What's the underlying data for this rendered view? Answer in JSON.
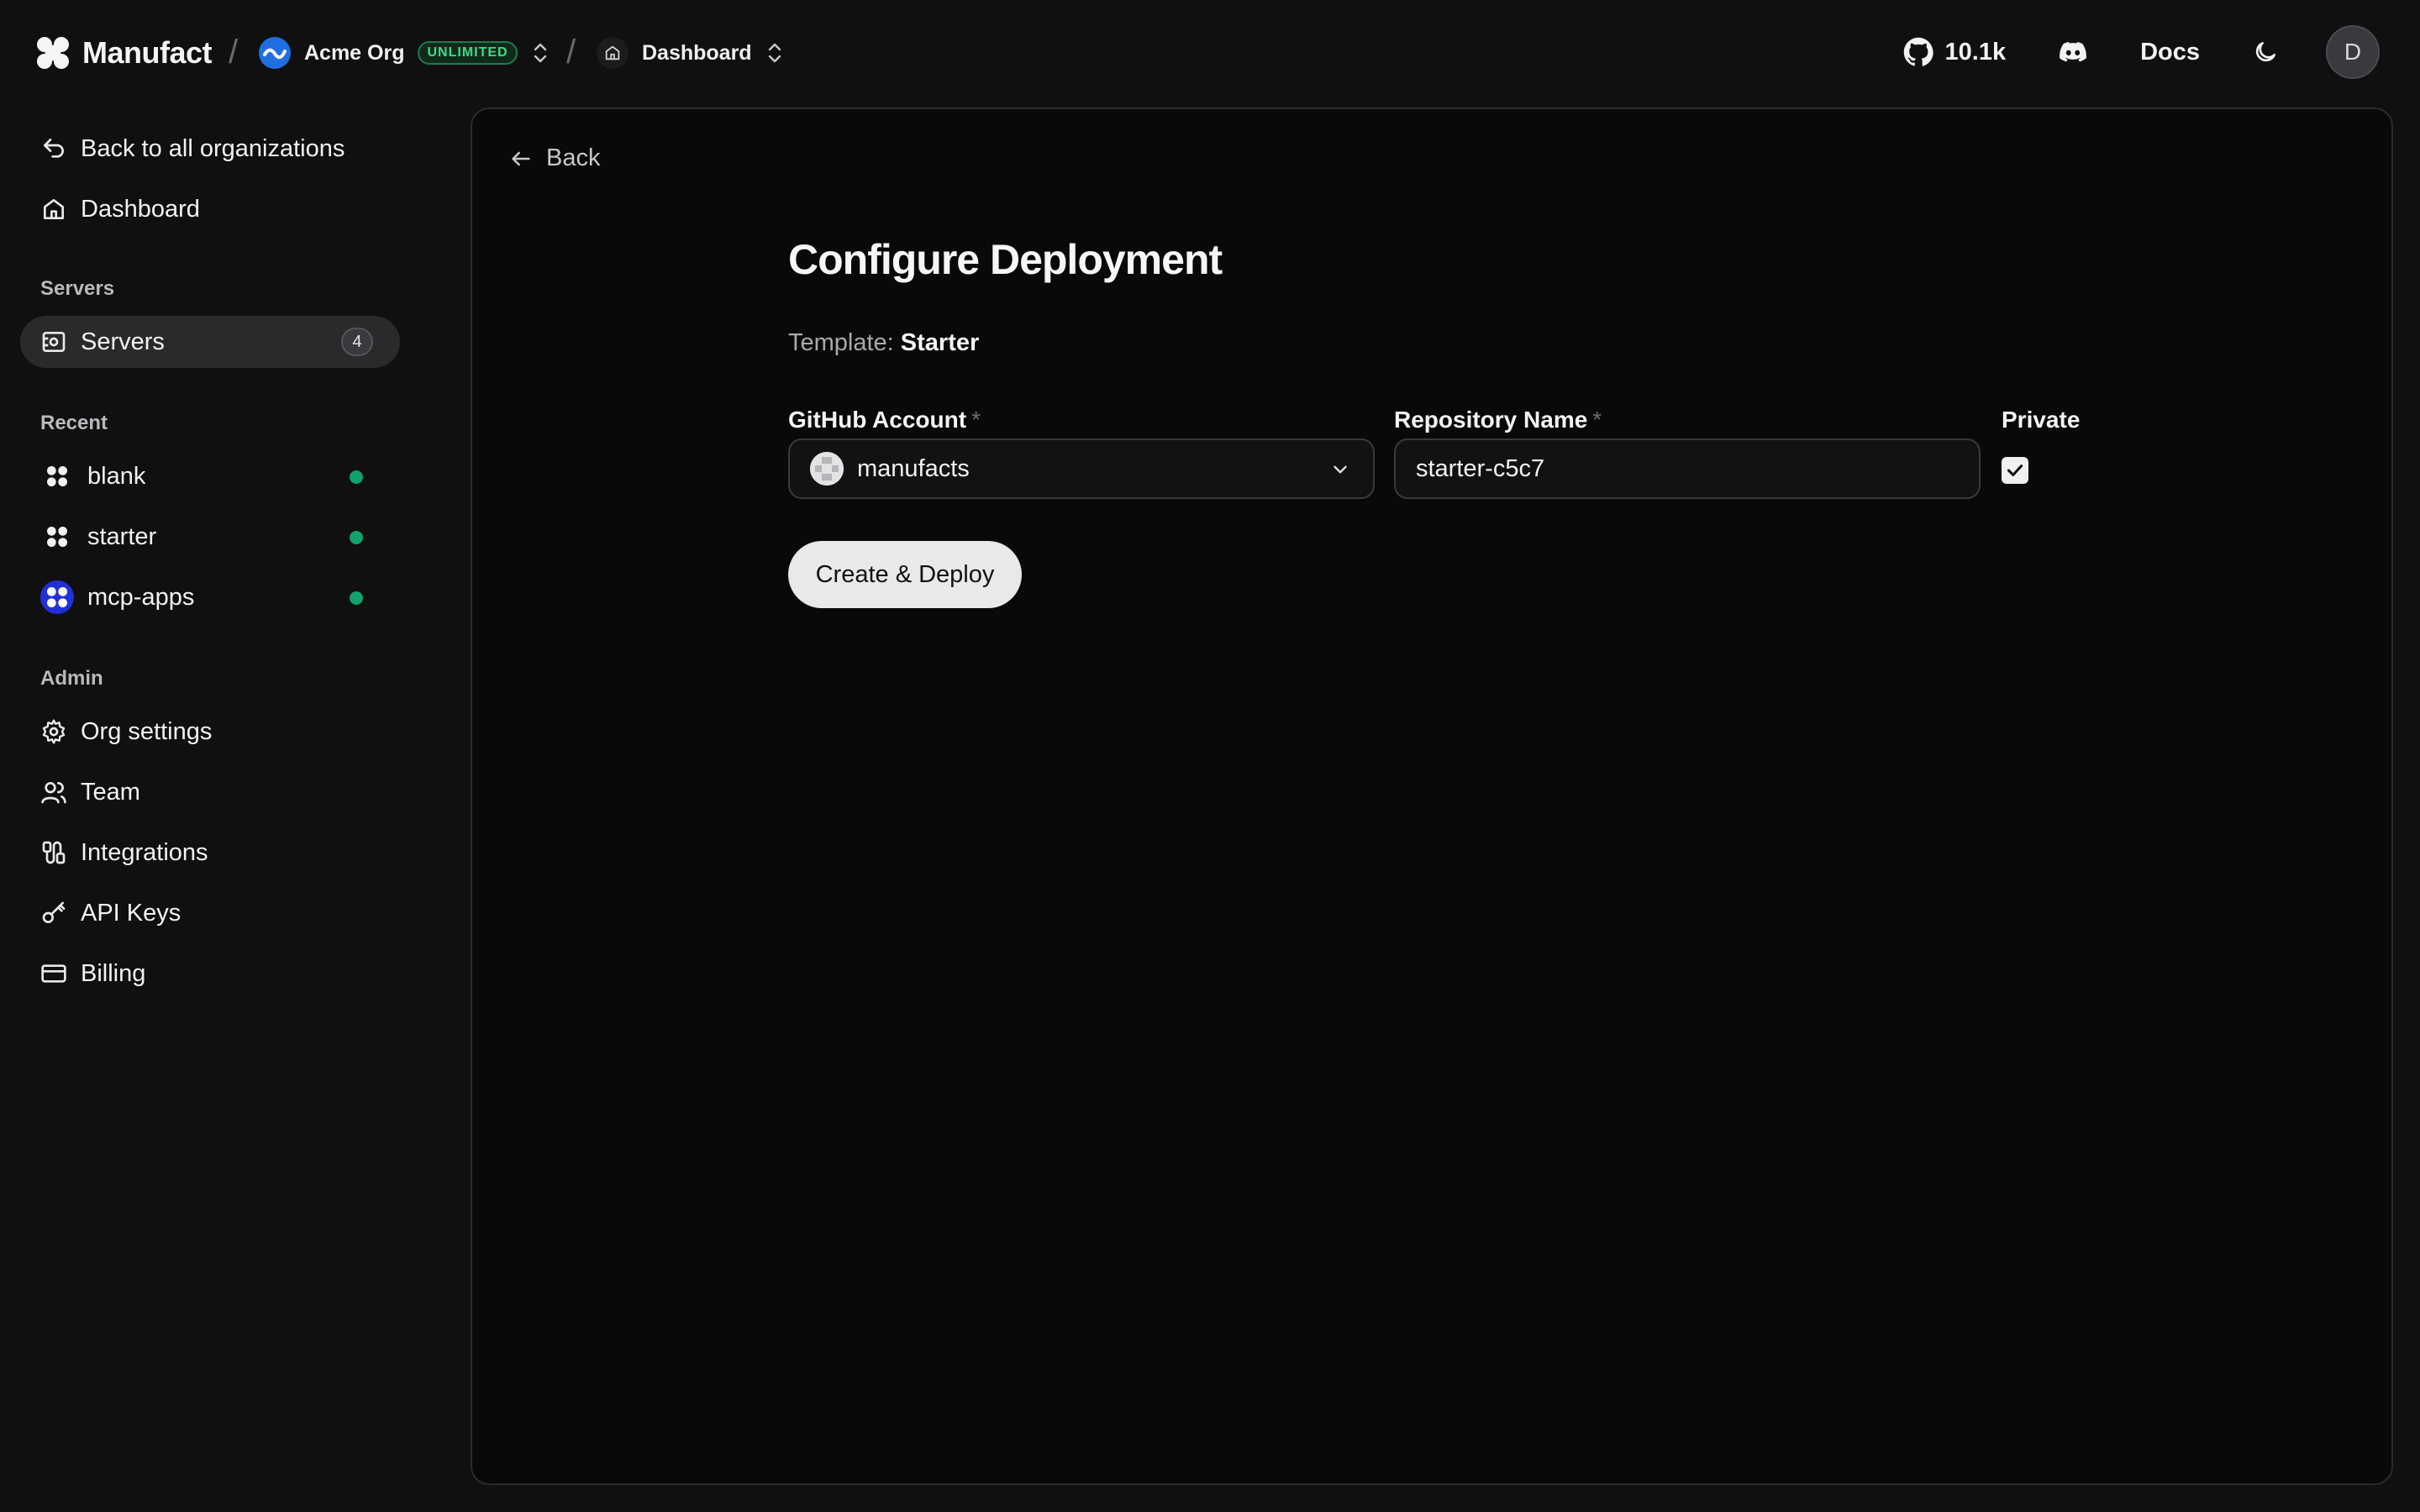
{
  "header": {
    "brand": "Manufact",
    "org_name": "Acme Org",
    "org_badge": "UNLIMITED",
    "dashboard_label": "Dashboard",
    "github_stars": "10.1k",
    "docs_label": "Docs",
    "user_initial": "D"
  },
  "sidebar": {
    "back_label": "Back to all organizations",
    "dashboard_label": "Dashboard",
    "servers_section": "Servers",
    "servers_label": "Servers",
    "servers_count": "4",
    "recent_section": "Recent",
    "recent": [
      {
        "label": "blank"
      },
      {
        "label": "starter"
      },
      {
        "label": "mcp-apps"
      }
    ],
    "admin_section": "Admin",
    "admin": [
      {
        "label": "Org settings"
      },
      {
        "label": "Team"
      },
      {
        "label": "Integrations"
      },
      {
        "label": "API Keys"
      },
      {
        "label": "Billing"
      }
    ]
  },
  "main": {
    "back_label": "Back",
    "title": "Configure Deployment",
    "template_label": "Template:",
    "template_value": "Starter",
    "github_account_label": "GitHub Account",
    "github_account_value": "manufacts",
    "repo_name_label": "Repository Name",
    "repo_name_value": "starter-c5c7",
    "required_marker": "*",
    "private_label": "Private",
    "private_checked": true,
    "deploy_button": "Create & Deploy"
  },
  "colors": {
    "background": "#101011",
    "panel": "#09090a",
    "status_online": "#10a36b",
    "badge_green": "#3ddc84"
  }
}
